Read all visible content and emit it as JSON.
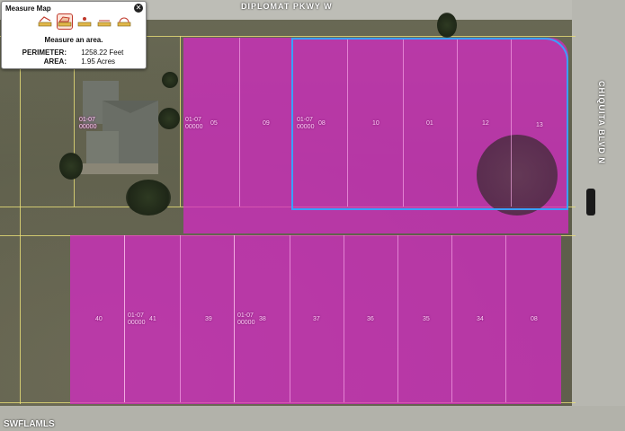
{
  "map": {
    "streets": {
      "top": "DIPLOMAT PKWY W",
      "right": "CHIQUITA BLVD N"
    },
    "parcels": [
      {
        "label": "01-07\n00000",
        "id": "p1"
      },
      {
        "label": "05",
        "id": "p2"
      },
      {
        "label": "01-07\n00000",
        "id": "p3"
      },
      {
        "label": "09",
        "id": "p4"
      },
      {
        "label": "10",
        "id": "p5"
      },
      {
        "label": "01",
        "id": "p6"
      },
      {
        "label": "12",
        "id": "p7"
      },
      {
        "label": "13",
        "id": "p8"
      },
      {
        "label": "08",
        "id": "p9"
      },
      {
        "label": "01-07\n00000",
        "id": "p10"
      },
      {
        "label": "08",
        "id": "p11"
      },
      {
        "label": "40",
        "id": "p12"
      },
      {
        "label": "41",
        "id": "p13"
      },
      {
        "label": "01-07\n00000",
        "id": "p14"
      },
      {
        "label": "39",
        "id": "p15"
      },
      {
        "label": "38",
        "id": "p16"
      },
      {
        "label": "37",
        "id": "p17"
      },
      {
        "label": "36",
        "id": "p18"
      },
      {
        "label": "35",
        "id": "p19"
      },
      {
        "label": "34",
        "id": "p20"
      },
      {
        "label": "01-07\n00000",
        "id": "p21"
      }
    ],
    "watermark": "SWFLAMLS",
    "overlay_color": "#d828c8",
    "selection_color": "#3aa0ff"
  },
  "measure_panel": {
    "title": "Measure Map",
    "close_icon": "close-icon",
    "tools": [
      {
        "icon": "measure-line-icon",
        "active": false
      },
      {
        "icon": "measure-area-icon",
        "active": true
      },
      {
        "icon": "measure-point-icon",
        "active": false
      },
      {
        "icon": "measure-radius-icon",
        "active": false
      },
      {
        "icon": "measure-circle-icon",
        "active": false
      }
    ],
    "instruction": "Measure an area.",
    "perimeter_label": "PERIMETER:",
    "perimeter_value": "1258.22 Feet",
    "area_label": "AREA:",
    "area_value": "1.95 Acres"
  }
}
